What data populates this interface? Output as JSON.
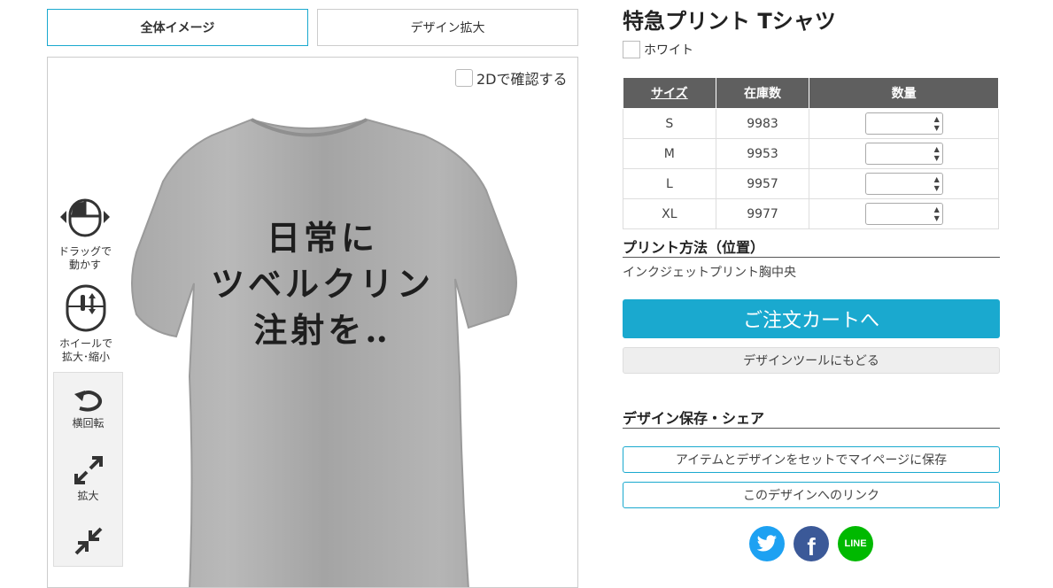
{
  "tabs": {
    "overview": "全体イメージ",
    "zoom": "デザイン拡大"
  },
  "viewer": {
    "check_2d_label": "2Dで確認する",
    "drag_hint": [
      "ドラッグで",
      "動かす"
    ],
    "wheel_hint": [
      "ホイールで",
      "拡大･縮小"
    ],
    "tools": {
      "rotate": "横回転",
      "zoom_in": "拡大"
    },
    "shirt_lines": [
      "日常に",
      "ツベルクリン",
      "注射を‥"
    ]
  },
  "product": {
    "title": "特急プリント Tシャツ",
    "color": "ホワイト",
    "color_swatch": "#ffffff"
  },
  "stock_table": {
    "headers": {
      "size": "サイズ",
      "stock": "在庫数",
      "qty": "数量"
    },
    "rows": [
      {
        "size": "S",
        "stock": "9983"
      },
      {
        "size": "M",
        "stock": "9953"
      },
      {
        "size": "L",
        "stock": "9957"
      },
      {
        "size": "XL",
        "stock": "9977"
      }
    ]
  },
  "print": {
    "heading": "プリント方法（位置）",
    "method": "インクジェットプリント胸中央"
  },
  "actions": {
    "cart": "ご注文カートへ",
    "back": "デザインツールにもどる"
  },
  "save": {
    "heading": "デザイン保存・シェア",
    "save_mypage": "アイテムとデザインをセットでマイページに保存",
    "link": "このデザインへのリンク"
  },
  "social": {
    "line_label": "LINE"
  },
  "colors": {
    "accent": "#1aa9cf",
    "twitter": "#1da1f2",
    "facebook": "#3b5998",
    "line": "#00b900",
    "table_header": "#5f5f5f"
  }
}
